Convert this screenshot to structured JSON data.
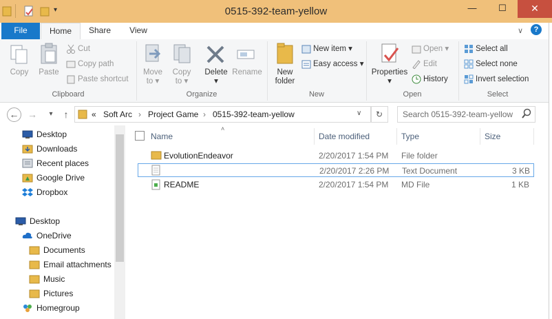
{
  "window": {
    "title": "0515-392-team-yellow"
  },
  "ribbon": {
    "tabs": {
      "file": "File",
      "home": "Home",
      "share": "Share",
      "view": "View"
    },
    "clipboard": {
      "copy": "Copy",
      "paste": "Paste",
      "cut": "Cut",
      "copy_path": "Copy path",
      "paste_shortcut": "Paste shortcut",
      "label": "Clipboard"
    },
    "organize": {
      "move_to_1": "Move",
      "move_to_2": "to",
      "copy_to_1": "Copy",
      "copy_to_2": "to",
      "delete": "Delete",
      "rename": "Rename",
      "label": "Organize"
    },
    "new": {
      "new_folder_1": "New",
      "new_folder_2": "folder",
      "new_item": "New item",
      "easy_access": "Easy access",
      "label": "New"
    },
    "open": {
      "properties": "Properties",
      "open": "Open",
      "edit": "Edit",
      "history": "History",
      "label": "Open"
    },
    "select": {
      "select_all": "Select all",
      "select_none": "Select none",
      "invert": "Invert selection",
      "label": "Select"
    }
  },
  "address": {
    "prefix": "«",
    "crumbs": [
      "Soft Arc",
      "Project Game",
      "0515-392-team-yellow"
    ],
    "search_placeholder": "Search 0515-392-team-yellow"
  },
  "nav": {
    "favorites": [
      "Desktop",
      "Downloads",
      "Recent places",
      "Google Drive",
      "Dropbox"
    ],
    "desktop": "Desktop",
    "onedrive": "OneDrive",
    "onedrive_children": [
      "Documents",
      "Email attachments",
      "Music",
      "Pictures"
    ],
    "homegroup": "Homegroup"
  },
  "columns": {
    "name": "Name",
    "date": "Date modified",
    "type": "Type",
    "size": "Size"
  },
  "files": [
    {
      "name": "EvolutionEndeavor",
      "date": "2/20/2017 1:54 PM",
      "type": "File folder",
      "size": ""
    },
    {
      "name": "",
      "date": "2/20/2017 2:26 PM",
      "type": "Text Document",
      "size": "3 KB"
    },
    {
      "name": "README",
      "date": "2/20/2017 1:54 PM",
      "type": "MD File",
      "size": "1 KB"
    }
  ],
  "colors": {
    "file_tab": "#1979ca",
    "titlebar": "#f0c07a",
    "close": "#c7503f",
    "folder": "#e8b94a"
  }
}
